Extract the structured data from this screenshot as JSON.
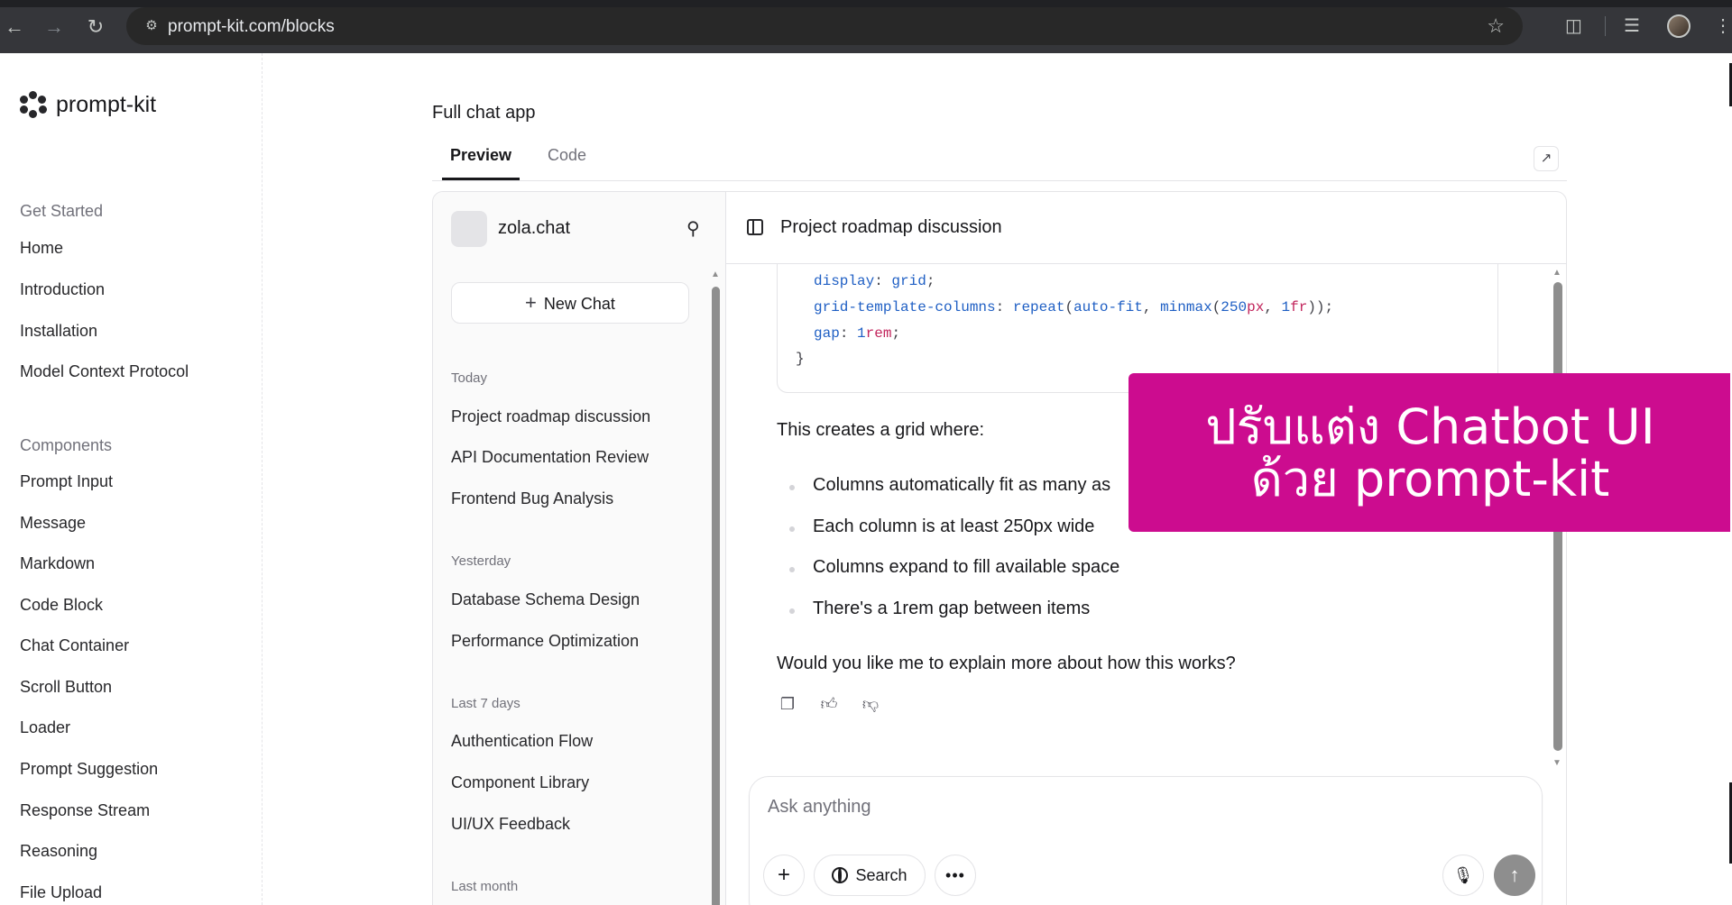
{
  "browser": {
    "url": "prompt-kit.com/blocks"
  },
  "docs": {
    "logo_text": "prompt-kit",
    "sections": [
      {
        "title": "Get Started",
        "items": [
          "Home",
          "Introduction",
          "Installation",
          "Model Context Protocol"
        ]
      },
      {
        "title": "Components",
        "items": [
          "Prompt Input",
          "Message",
          "Markdown",
          "Code Block",
          "Chat Container",
          "Scroll Button",
          "Loader",
          "Prompt Suggestion",
          "Response Stream",
          "Reasoning",
          "File Upload"
        ]
      }
    ]
  },
  "main": {
    "title": "Full chat app",
    "tabs": [
      "Preview",
      "Code"
    ],
    "active_tab": "Preview"
  },
  "chat_app": {
    "brand": "zola.chat",
    "new_chat_label": "New Chat",
    "groups": [
      {
        "label": "Today",
        "items": [
          "Project roadmap discussion",
          "API Documentation Review",
          "Frontend Bug Analysis"
        ]
      },
      {
        "label": "Yesterday",
        "items": [
          "Database Schema Design",
          "Performance Optimization"
        ]
      },
      {
        "label": "Last 7 days",
        "items": [
          "Authentication Flow",
          "Component Library",
          "UI/UX Feedback"
        ]
      },
      {
        "label": "Last month",
        "items": []
      }
    ],
    "conversation_title": "Project roadmap discussion",
    "code": {
      "line1_prop": "display",
      "line1_val": "grid",
      "line2_prop": "grid-template-columns",
      "line2_fn": "repeat",
      "line2_arg1": "auto-fit",
      "line2_fn2": "minmax",
      "line2_num1": "250",
      "line2_unit1": "px",
      "line2_num2": "1",
      "line2_unit2": "fr",
      "line3_prop": "gap",
      "line3_num": "1",
      "line3_unit": "rem",
      "closing": "}"
    },
    "message_intro": "This creates a grid where:",
    "bullets": [
      "Columns automatically fit as many as",
      "Each column is at least 250px wide",
      "Columns expand to fill available space",
      "There's a 1rem gap between items"
    ],
    "message_outro": "Would you like me to explain more about how this works?",
    "composer": {
      "placeholder": "Ask anything",
      "search_label": "Search"
    }
  },
  "banner": {
    "line1": "ปรับแต่ง Chatbot UI",
    "line2": "ด้วย prompt-kit",
    "color": "#cc0c8f"
  }
}
